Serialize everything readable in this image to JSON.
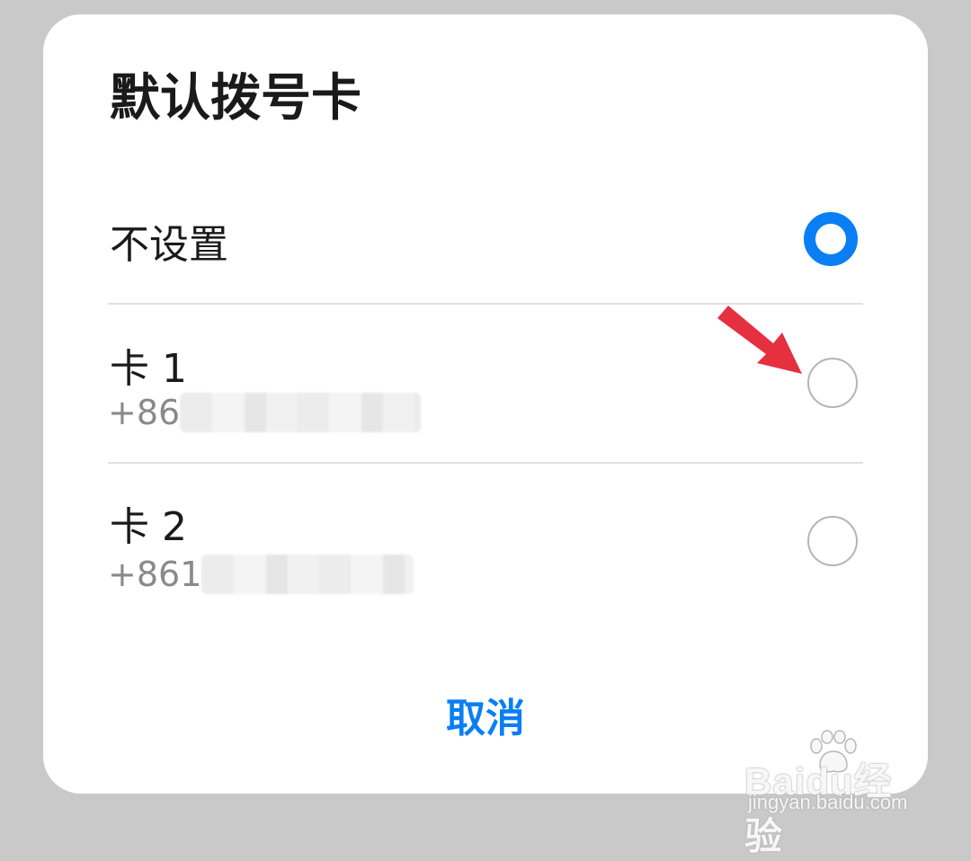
{
  "dialog": {
    "title": "默认拨号卡",
    "options": [
      {
        "label": "不设置",
        "sub": "",
        "checked": true
      },
      {
        "label": "卡 1",
        "sub": "+86",
        "checked": false
      },
      {
        "label": "卡 2",
        "sub": "+861",
        "checked": false
      }
    ],
    "cancel_label": "取消"
  },
  "colors": {
    "accent": "#0a7ff4",
    "annotation_arrow": "#e53040"
  },
  "watermark": {
    "brand": "Baidu经验",
    "url": "jingyan.baidu.com"
  }
}
